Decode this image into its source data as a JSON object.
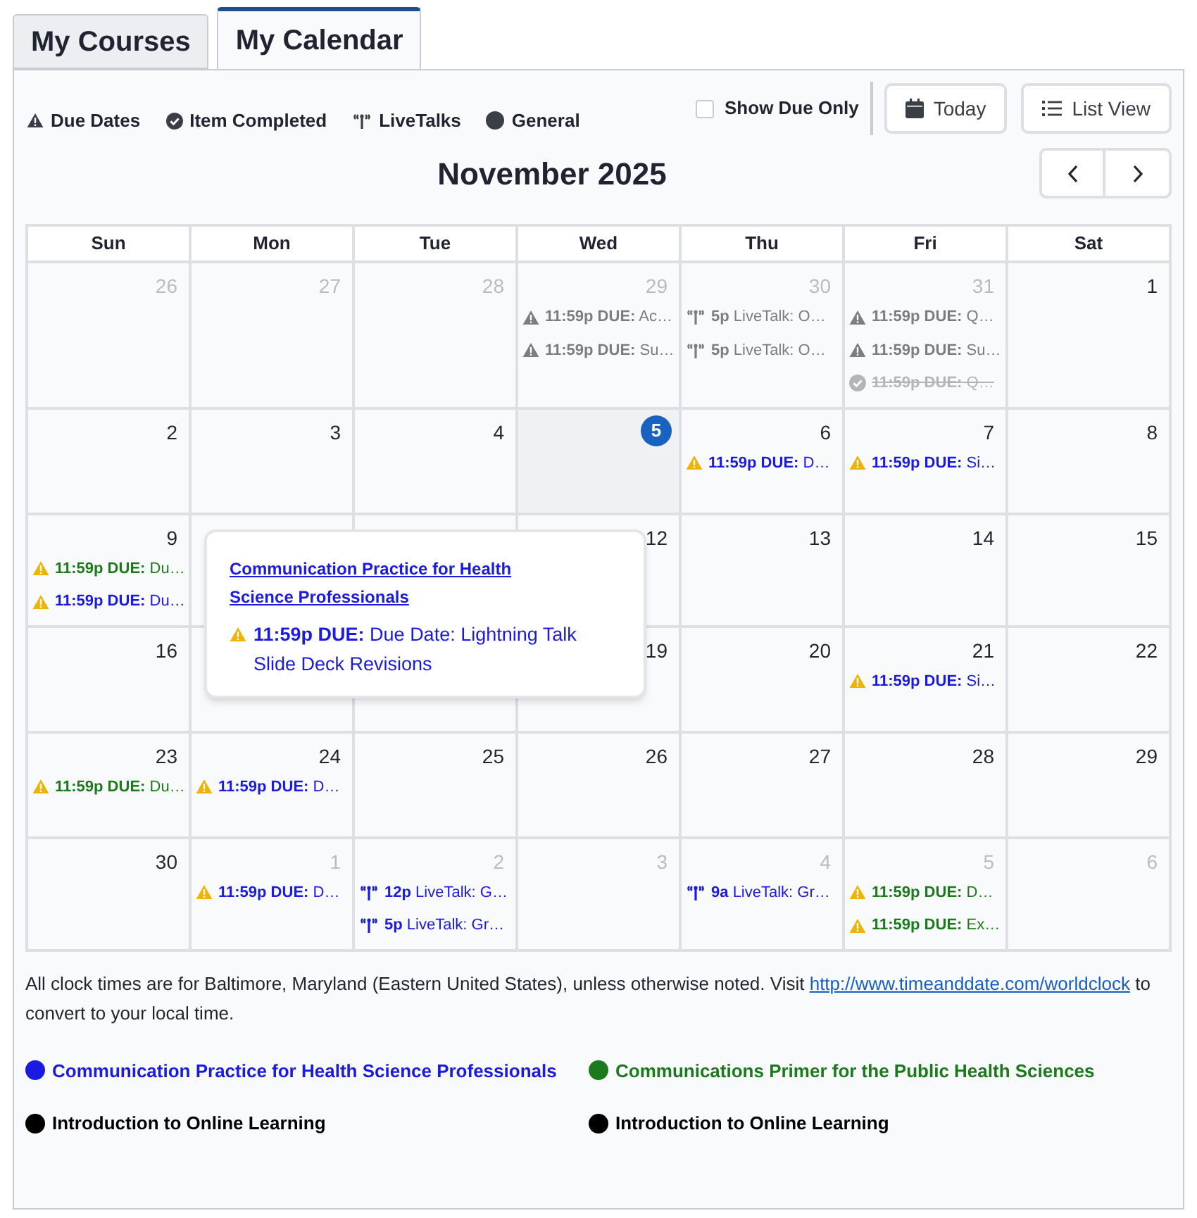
{
  "tabs": [
    {
      "label": "My Courses",
      "selected": false
    },
    {
      "label": "My Calendar",
      "selected": true
    }
  ],
  "legend": [
    {
      "kind": "due",
      "label": "Due Dates"
    },
    {
      "kind": "completed",
      "label": "Item Completed"
    },
    {
      "kind": "livetalk",
      "label": "LiveTalks"
    },
    {
      "kind": "general",
      "label": "General"
    }
  ],
  "show_due_only": {
    "label": "Show Due Only",
    "checked": false
  },
  "buttons": [
    {
      "kind": "today",
      "label": "Today"
    },
    {
      "kind": "list",
      "label": "List View"
    }
  ],
  "month_title": "November 2025",
  "weekdays": [
    "Sun",
    "Mon",
    "Tue",
    "Wed",
    "Thu",
    "Fri",
    "Sat"
  ],
  "weeks": [
    [
      {
        "day": "26",
        "outside": true,
        "today": false
      },
      {
        "day": "27",
        "outside": true,
        "today": false
      },
      {
        "day": "28",
        "outside": true,
        "today": false
      },
      {
        "day": "29",
        "outside": true,
        "today": false,
        "events": [
          {
            "kind": "due",
            "color": "#7d7d7d",
            "lead": "11:59p DUE:",
            "text": "Ac…"
          },
          {
            "kind": "due",
            "color": "#7d7d7d",
            "lead": "11:59p DUE:",
            "text": "Su…"
          }
        ]
      },
      {
        "day": "30",
        "outside": true,
        "today": false,
        "events": [
          {
            "kind": "livetalk",
            "color": "#7d7d7d",
            "lead": "5p",
            "text": "LiveTalk: O…"
          },
          {
            "kind": "livetalk",
            "color": "#7d7d7d",
            "lead": "5p",
            "text": "LiveTalk: O…"
          }
        ]
      },
      {
        "day": "31",
        "outside": true,
        "today": false,
        "events": [
          {
            "kind": "due",
            "color": "#7d7d7d",
            "lead": "11:59p DUE:",
            "text": "Q…"
          },
          {
            "kind": "due",
            "color": "#7d7d7d",
            "lead": "11:59p DUE:",
            "text": "Su…"
          },
          {
            "kind": "completed",
            "color": "#b5b5b5",
            "lead": "11:59p DUE:",
            "text": "Q…"
          }
        ]
      },
      {
        "day": "1",
        "outside": false,
        "today": false
      }
    ],
    [
      {
        "day": "2",
        "outside": false,
        "today": false
      },
      {
        "day": "3",
        "outside": false,
        "today": false
      },
      {
        "day": "4",
        "outside": false,
        "today": false
      },
      {
        "day": "5",
        "outside": false,
        "today": true
      },
      {
        "day": "6",
        "outside": false,
        "today": false,
        "events": [
          {
            "kind": "due",
            "color": "#1a1ae0",
            "lead": "11:59p DUE:",
            "text": "D…"
          }
        ]
      },
      {
        "day": "7",
        "outside": false,
        "today": false,
        "events": [
          {
            "kind": "due",
            "color": "#1a1ae0",
            "lead": "11:59p DUE:",
            "text": "Si…"
          }
        ]
      },
      {
        "day": "8",
        "outside": false,
        "today": false
      }
    ],
    [
      {
        "day": "9",
        "outside": false,
        "today": false,
        "events": [
          {
            "kind": "due",
            "color": "#1b7a1b",
            "lead": "11:59p DUE:",
            "text": "Du…"
          },
          {
            "kind": "due",
            "color": "#1a1ae0",
            "lead": "11:59p DUE:",
            "text": "Du…"
          }
        ]
      },
      {
        "day": "12",
        "outside": false,
        "today": false
      },
      {
        "day": "13",
        "outside": false,
        "today": false
      },
      {
        "day": "14",
        "outside": false,
        "today": false
      },
      {
        "day": "15",
        "outside": false,
        "today": false
      }
    ],
    [
      {
        "day": "16",
        "outside": false,
        "today": false
      },
      {
        "day": "19",
        "outside": false,
        "today": false
      },
      {
        "day": "20",
        "outside": false,
        "today": false
      },
      {
        "day": "21",
        "outside": false,
        "today": false,
        "events": [
          {
            "kind": "due",
            "color": "#1a1ae0",
            "lead": "11:59p DUE:",
            "text": "Si…"
          }
        ]
      },
      {
        "day": "22",
        "outside": false,
        "today": false
      }
    ],
    [
      {
        "day": "23",
        "outside": false,
        "today": false,
        "events": [
          {
            "kind": "due",
            "color": "#1b7a1b",
            "lead": "11:59p DUE:",
            "text": "Du…"
          }
        ]
      },
      {
        "day": "24",
        "outside": false,
        "today": false,
        "events": [
          {
            "kind": "due",
            "color": "#1a1ae0",
            "lead": "11:59p DUE:",
            "text": "D…"
          }
        ]
      },
      {
        "day": "25",
        "outside": false,
        "today": false
      },
      {
        "day": "26",
        "outside": false,
        "today": false
      },
      {
        "day": "27",
        "outside": false,
        "today": false
      },
      {
        "day": "28",
        "outside": false,
        "today": false
      },
      {
        "day": "29",
        "outside": false,
        "today": false
      }
    ],
    [
      {
        "day": "30",
        "outside": false,
        "today": false
      },
      {
        "day": "1",
        "outside": true,
        "today": false,
        "events": [
          {
            "kind": "due",
            "color": "#1a1ae0",
            "lead": "11:59p DUE:",
            "text": "D…"
          }
        ]
      },
      {
        "day": "2",
        "outside": true,
        "today": false,
        "events": [
          {
            "kind": "livetalk",
            "color": "#1a1ae0",
            "lead": "12p",
            "text": "LiveTalk: G…"
          },
          {
            "kind": "livetalk",
            "color": "#1a1ae0",
            "lead": "5p",
            "text": "LiveTalk: Gr…"
          }
        ]
      },
      {
        "day": "3",
        "outside": true,
        "today": false
      },
      {
        "day": "4",
        "outside": true,
        "today": false,
        "events": [
          {
            "kind": "livetalk",
            "color": "#1a1ae0",
            "lead": "9a",
            "text": "LiveTalk: Gr…"
          }
        ]
      },
      {
        "day": "5",
        "outside": true,
        "today": false,
        "events": [
          {
            "kind": "due",
            "color": "#1b7a1b",
            "lead": "11:59p DUE:",
            "text": "D…"
          },
          {
            "kind": "due",
            "color": "#1b7a1b",
            "lead": "11:59p DUE:",
            "text": "Ex…"
          }
        ]
      },
      {
        "day": "6",
        "outside": true,
        "today": false
      }
    ]
  ],
  "popover": {
    "course": "Communication Practice for Health Science Professionals",
    "event": {
      "kind": "due",
      "color": "#1a1ae0",
      "lead": "11:59p DUE:",
      "text": "Due Date: Lightning Talk Slide Deck Revisions"
    }
  },
  "footnote": {
    "before": "All clock times are for Baltimore, Maryland (Eastern United States), unless otherwise noted. Visit",
    "link": "http://www.timeanddate.com/worldclock",
    "after": "to convert to your local time."
  },
  "courses": [
    {
      "label": "Communication Practice for Health Science Professionals",
      "color": "#1a1ae0"
    },
    {
      "label": "Communications Primer for the Public Health Sciences",
      "color": "#1b7a1b"
    },
    {
      "label": "Introduction to Online Learning",
      "color": "#000000"
    },
    {
      "label": "Introduction to Online Learning",
      "color": "#000000"
    }
  ]
}
